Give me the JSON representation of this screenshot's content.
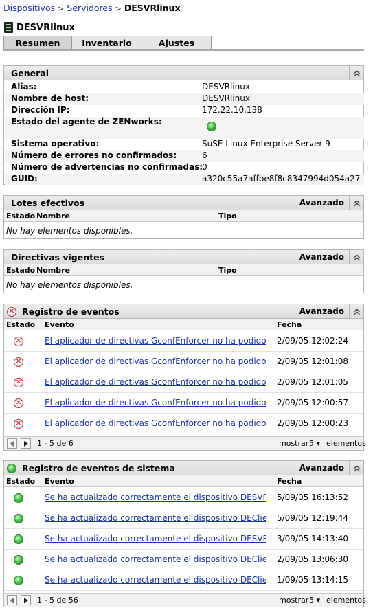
{
  "breadcrumb": [
    "Dispositivos",
    "Servidores",
    "DESVRlinux"
  ],
  "device": {
    "name": "DESVRlinux"
  },
  "tabs": [
    "Resumen",
    "Inventario",
    "Ajustes"
  ],
  "general": {
    "title": "General",
    "fields": [
      {
        "label": "Alias:",
        "value": "DESVRlinux"
      },
      {
        "label": "Nombre de host:",
        "value": "DESVRlinux"
      },
      {
        "label": "Dirección IP:",
        "value": "172.22.10.138"
      },
      {
        "label": "Estado del agente de ZENworks:",
        "value": ""
      },
      {
        "label": "Sistema operativo:",
        "value": "SuSE Linux Enterprise Server 9"
      },
      {
        "label": "Número de errores no confirmados:",
        "value": "6"
      },
      {
        "label": "Número de advertencias no confirmadas:",
        "value": "0"
      },
      {
        "label": "GUID:",
        "value": "a320c55a7affbe8f8c8347994d054a27"
      }
    ],
    "agent_status": "ok"
  },
  "lotes": {
    "title": "Lotes efectivos",
    "advanced": "Avanzado",
    "columns": [
      "Estado",
      "Nombre",
      "Tipo"
    ],
    "empty": "No hay elementos disponibles."
  },
  "directivas": {
    "title": "Directivas vigentes",
    "advanced": "Avanzado",
    "columns": [
      "Estado",
      "Nombre",
      "Tipo"
    ],
    "empty": "No hay elementos disponibles."
  },
  "eventos": {
    "title": "Registro de eventos",
    "advanced": "Avanzado",
    "columns": [
      "Estado",
      "Evento",
      "Fecha"
    ],
    "rows": [
      {
        "status": "error",
        "event": "El aplicador de directivas GconfEnforcer no ha podido l",
        "date": "2/09/05 12:02:24"
      },
      {
        "status": "error",
        "event": "El aplicador de directivas GconfEnforcer no ha podido l",
        "date": "2/09/05 12:01:08"
      },
      {
        "status": "error",
        "event": "El aplicador de directivas GconfEnforcer no ha podido l",
        "date": "2/09/05 12:01:05"
      },
      {
        "status": "error",
        "event": "El aplicador de directivas GconfEnforcer no ha podido l",
        "date": "2/09/05 12:00:57"
      },
      {
        "status": "error",
        "event": "El aplicador de directivas GconfEnforcer no ha podido l",
        "date": "2/09/05 12:00:23"
      }
    ],
    "pager": {
      "range": "1 - 5 de 6",
      "show": "mostrar",
      "count": "5",
      "items": "elementos"
    }
  },
  "sistema": {
    "title": "Registro de eventos de sistema",
    "advanced": "Avanzado",
    "columns": [
      "Estado",
      "Evento",
      "Fecha"
    ],
    "rows": [
      {
        "status": "ok",
        "event": "Se ha actualizado correctamente el dispositivo DESVR",
        "date": "5/09/05 16:13:52"
      },
      {
        "status": "ok",
        "event": "Se ha actualizado correctamente el dispositivo DEClier",
        "date": "5/09/05 12:19:44"
      },
      {
        "status": "ok",
        "event": "Se ha actualizado correctamente el dispositivo DESVR",
        "date": "3/09/05 14:13:40"
      },
      {
        "status": "ok",
        "event": "Se ha actualizado correctamente el dispositivo DEClier",
        "date": "2/09/05 13:06:30"
      },
      {
        "status": "ok",
        "event": "Se ha actualizado correctamente el dispositivo DEClier",
        "date": "1/09/05 13:14:15"
      }
    ],
    "pager": {
      "range": "1 - 5 de 56",
      "show": "mostrar",
      "count": "5",
      "items": "elementos"
    }
  },
  "colors": {
    "link": "#1a37a6",
    "ok": "#4cc24c",
    "error": "#d01010",
    "header_bg": "#e4e4e4",
    "border": "#b4b4b4"
  }
}
